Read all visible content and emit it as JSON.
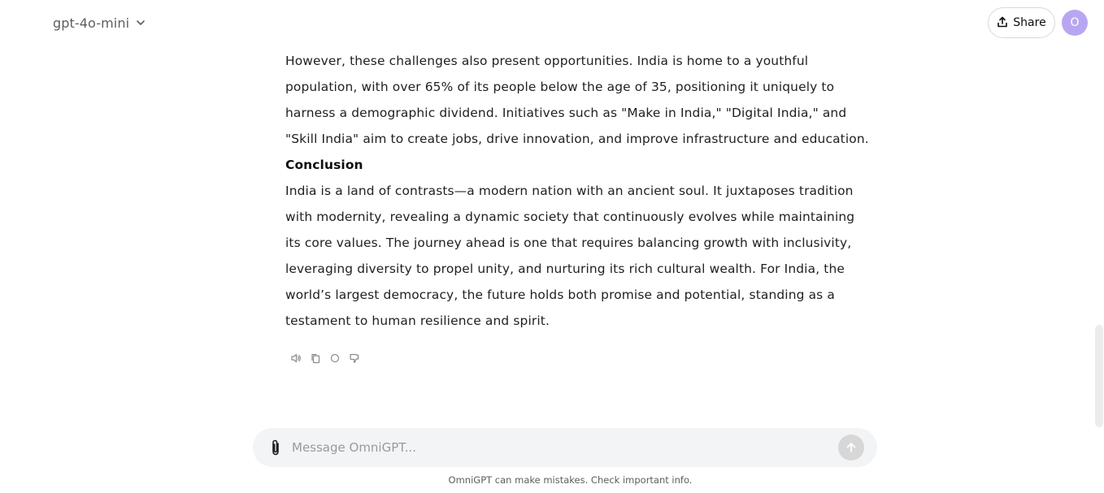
{
  "header": {
    "model_label": "gpt-4o-mini",
    "share_label": "Share",
    "avatar_initial": "O"
  },
  "message": {
    "paragraph1": "However, these challenges also present opportunities. India is home to a youthful population, with over 65% of its people below the age of 35, positioning it uniquely to harness a demographic dividend. Initiatives such as \"Make in India,\" \"Digital India,\" and \"Skill India\" aim to create jobs, drive innovation, and improve infrastructure and education.",
    "heading": "Conclusion",
    "paragraph2": "India is a land of contrasts—a modern nation with an ancient soul. It juxtaposes tradition with modernity, revealing a dynamic society that continuously evolves while maintaining its core values. The journey ahead is one that requires balancing growth with inclusivity, leveraging diversity to propel unity, and nurturing its rich cultural wealth. For India, the world’s largest democracy, the future holds both promise and potential, standing as a testament to human resilience and spirit.",
    "actions": [
      "speaker-icon",
      "copy-icon",
      "regenerate-icon",
      "thumbs-down-icon"
    ]
  },
  "composer": {
    "placeholder": "Message OmniGPT...",
    "value": ""
  },
  "footer": {
    "disclaimer": "OmniGPT can make mistakes. Check important info."
  },
  "colors": {
    "avatar_bg": "#b9a6f2",
    "composer_bg": "#f3f4f6",
    "send_button_bg": "#d7d7d7"
  }
}
